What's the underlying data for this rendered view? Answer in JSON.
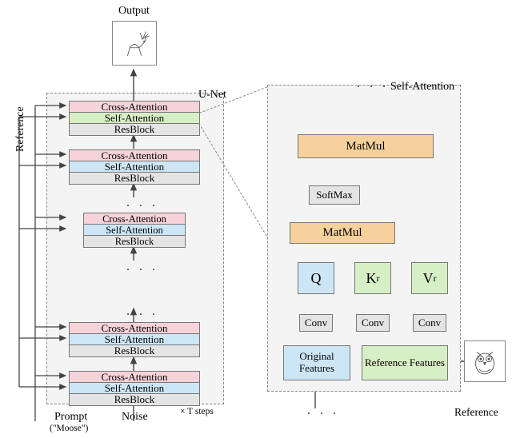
{
  "labels": {
    "output": "Output",
    "unet": "U-Net",
    "self_attention_title": "Self-Attention",
    "reference_side": "Reference",
    "prompt": "Prompt",
    "prompt_value": "(\"Moose\")",
    "noise": "Noise",
    "t_steps": "× T steps",
    "reference": "Reference"
  },
  "unet": {
    "blocks": [
      {
        "cross": "Cross-Attention",
        "self": "Self-Attention",
        "res": "ResBlock",
        "self_highlight": true
      },
      {
        "cross": "Cross-Attention",
        "self": "Self-Attention",
        "res": "ResBlock",
        "self_highlight": false
      },
      {
        "cross": "Cross-Attention",
        "self": "Self-Attention",
        "res": "ResBlock",
        "self_highlight": false
      },
      {
        "cross": "Cross-Attention",
        "self": "Self-Attention",
        "res": "ResBlock",
        "self_highlight": false
      },
      {
        "cross": "Cross-Attention",
        "self": "Self-Attention",
        "res": "ResBlock",
        "self_highlight": false
      }
    ]
  },
  "sa": {
    "matmul2": "MatMul",
    "softmax": "SoftMax",
    "matmul1": "MatMul",
    "q": "Q",
    "k": "K",
    "v": "V",
    "k_sub": "r",
    "v_sub": "r",
    "convq": "Conv",
    "convk": "Conv",
    "convv": "Conv",
    "orig_feat": "Original Features",
    "ref_feat": "Reference Features"
  }
}
